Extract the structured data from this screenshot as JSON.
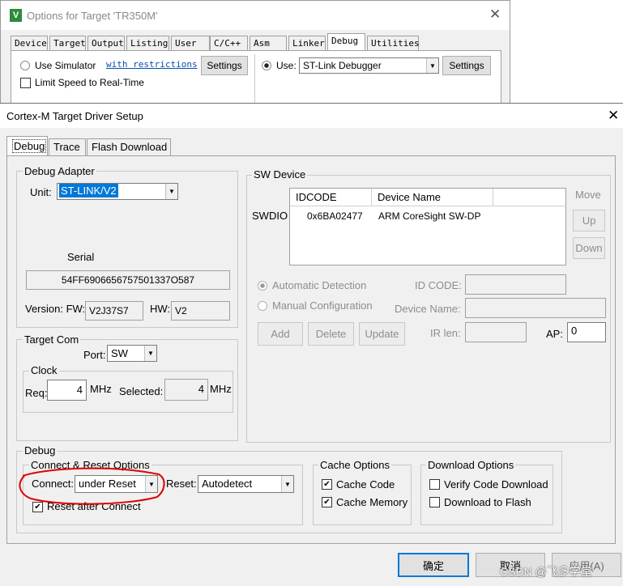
{
  "back_window": {
    "title": "Options for Target 'TR350M'",
    "tabs": [
      "Device",
      "Target",
      "Output",
      "Listing",
      "User",
      "C/C++",
      "Asm",
      "Linker",
      "Debug",
      "Utilities"
    ],
    "use_simulator": "Use Simulator",
    "with_restrictions": "with restrictions",
    "settings_left": "Settings",
    "limit_speed": "Limit Speed to Real-Time",
    "use_label": "Use:",
    "debugger": "ST-Link Debugger",
    "settings_right": "Settings"
  },
  "dialog": {
    "title": "Cortex-M Target Driver Setup",
    "tabs": [
      "Debug",
      "Trace",
      "Flash Download"
    ],
    "debug_adapter": {
      "title": "Debug Adapter",
      "unit_label": "Unit:",
      "unit_value": "ST-LINK/V2",
      "serial_label": "Serial",
      "serial_value": "54FF6906656757501337O587",
      "version_label": "Version: FW:",
      "fw_value": "V2J37S7",
      "hw_label": "HW:",
      "hw_value": "V2"
    },
    "target_com": {
      "title": "Target Com",
      "port_label": "Port:",
      "port_value": "SW",
      "clock_title": "Clock",
      "req_label": "Req:",
      "req_value": "4",
      "req_unit": "MHz",
      "selected_label": "Selected:",
      "selected_value": "4",
      "selected_unit": "MHz"
    },
    "sw_device": {
      "title": "SW Device",
      "columns": [
        "IDCODE",
        "Device Name"
      ],
      "row_label": "SWDIO",
      "rows": [
        {
          "idcode": "0x6BA02477",
          "name": "ARM CoreSight SW-DP"
        }
      ],
      "move_label": "Move",
      "up": "Up",
      "down": "Down",
      "automatic_detection": "Automatic Detection",
      "manual_configuration": "Manual Configuration",
      "id_code_label": "ID CODE:",
      "device_name_label": "Device Name:",
      "add": "Add",
      "delete": "Delete",
      "update": "Update",
      "ir_len_label": "IR len:",
      "ap_label": "AP:",
      "ap_value": "0"
    },
    "debug_section": {
      "title": "Debug",
      "connect_reset_title": "Connect & Reset Options",
      "connect_label": "Connect:",
      "connect_value": "under Reset",
      "reset_label": "Reset:",
      "reset_value": "Autodetect",
      "reset_after_connect": "Reset after Connect",
      "cache_title": "Cache Options",
      "cache_code": "Cache Code",
      "cache_memory": "Cache Memory",
      "download_title": "Download Options",
      "verify_code": "Verify Code Download",
      "download_flash": "Download to Flash"
    },
    "buttons": {
      "ok": "确定",
      "cancel": "取消",
      "apply": "应用(A)"
    },
    "watermark": "CSDN @飞多学堂",
    "colors": {
      "highlight": "#0078d7",
      "annotation": "#e00000"
    }
  }
}
